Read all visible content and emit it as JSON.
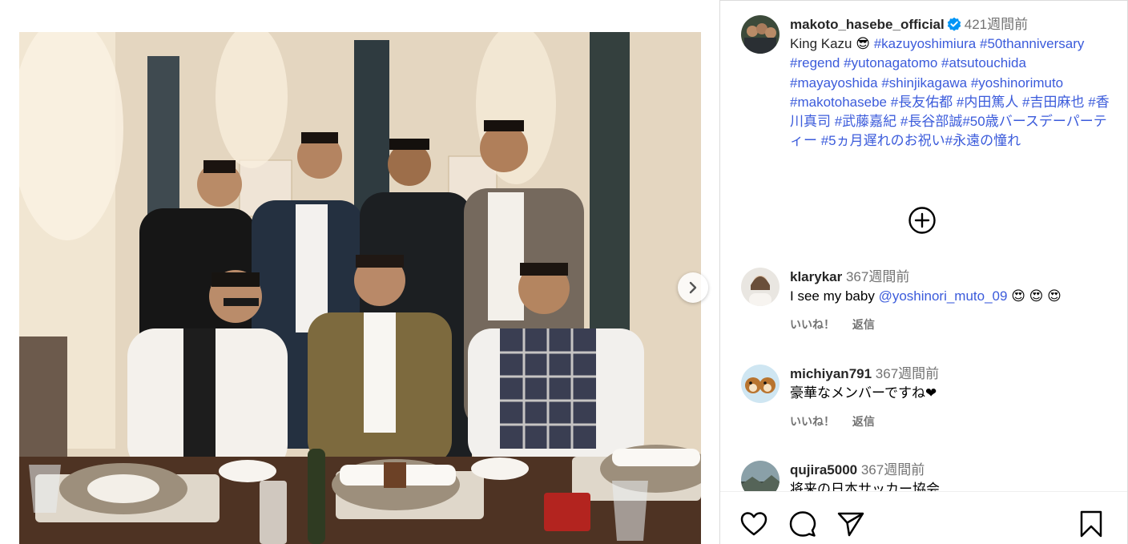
{
  "post": {
    "username": "makoto_hasebe_official",
    "time": "421週間前",
    "caption_text": "King Kazu",
    "caption_emoji": "😎",
    "caption_tags": "#kazuyoshimiura #50thanniversary #regend #yutonagatomo #atsutouchida #mayayoshida #shinjikagawa #yoshinorimuto #makotohasebe #長友佑都 #内田篤人 #吉田麻也 #香川真司 #武藤嘉紀 #長谷部誠#50歳バースデーパーティー #5ヵ月遅れのお祝い#永遠の憧れ"
  },
  "comments": [
    {
      "username": "klarykar",
      "time": "367週間前",
      "text": "I see my baby ",
      "mention": "@yoshinori_muto_09",
      "emoji": " 😍 😍 😍",
      "like": "いいね！",
      "reply": "返信"
    },
    {
      "username": "michiyan791",
      "time": "367週間前",
      "text": "豪華なメンバーですね❤",
      "mention": "",
      "emoji": "",
      "like": "いいね！",
      "reply": "返信"
    },
    {
      "username": "qujira5000",
      "time": "367週間前",
      "text": "将来の日本サッカー協会",
      "mention": "",
      "emoji": "",
      "like": "",
      "reply": ""
    }
  ],
  "icons": {
    "verified": "verified-badge-icon",
    "next": "chevron-right-icon",
    "load_more": "plus-circle-icon",
    "like": "heart-icon",
    "comment": "speech-bubble-icon",
    "share": "paper-plane-icon",
    "save": "bookmark-icon"
  },
  "colors": {
    "link": "#3b5bdb",
    "muted": "#737373",
    "verified": "#0095f6",
    "text": "#262626"
  }
}
